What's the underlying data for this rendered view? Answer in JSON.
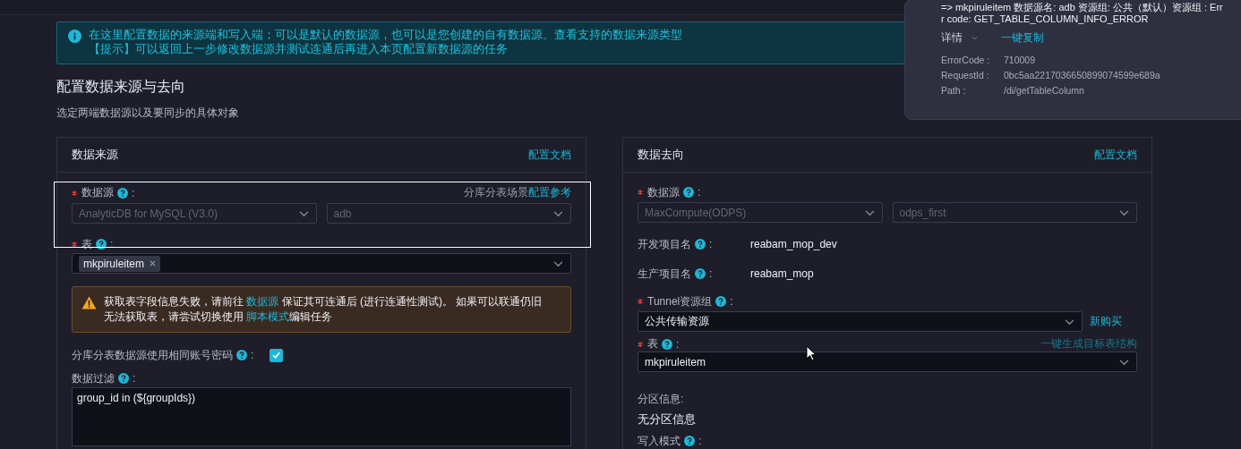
{
  "banner": {
    "lines": [
      "在这里配置数据的来源端和写入端；可以是默认的数据源，也可以是您创建的自有数据源。查看支持的数据来源类型",
      "【提示】可以返回上一步修改数据源并测试连通后再进入本页配置新数据源的任务"
    ]
  },
  "section": {
    "title": "配置数据来源与去向",
    "subtitle": "选定两端数据源以及要同步的具体对象"
  },
  "source": {
    "title": "数据来源",
    "doc_link": "配置文档",
    "datasource": {
      "label": "数据源",
      "colon": ":",
      "required": true,
      "hint": "分库分表场景",
      "hint_link": "配置参考",
      "type": "AnalyticDB for MySQL (V3.0)",
      "name": "adb"
    },
    "table": {
      "label": "表",
      "colon": ":",
      "required": true,
      "tags": [
        "mkpiruleitem"
      ]
    },
    "warning": {
      "segments": [
        {
          "text": "获取表字段信息失败，请前往 ",
          "link": false
        },
        {
          "text": "数据源",
          "link": true
        },
        {
          "text": " 保证其可连通后 (进行连通性测试)。 如果可以联通仍旧无法获取表，请尝试切换使用 ",
          "link": false
        },
        {
          "text": "脚本模式",
          "link": true
        },
        {
          "text": "编辑任务",
          "link": false
        }
      ]
    },
    "same_account": {
      "label": "分库分表数据源使用相同账号密码",
      "colon": ":",
      "checked": true
    },
    "filter": {
      "label": "数据过滤",
      "colon": ":",
      "value": "group_id in (${groupIds})"
    }
  },
  "target": {
    "title": "数据去向",
    "doc_link": "配置文档",
    "datasource": {
      "label": "数据源",
      "colon": ":",
      "required": true,
      "type": "MaxCompute(ODPS)",
      "name": "odps_first"
    },
    "info_rows": [
      {
        "label": "开发项目名",
        "colon": ":",
        "value": "reabam_mop_dev"
      },
      {
        "label": "生产项目名",
        "colon": ":",
        "value": "reabam_mop"
      }
    ],
    "tunnel": {
      "label": "Tunnel资源组",
      "colon": ":",
      "required": true,
      "value": "公共传输资源",
      "action": "新购买"
    },
    "table": {
      "label": "表",
      "colon": ":",
      "required": true,
      "value": "mkpiruleitem",
      "action": "一键生成目标表结构"
    },
    "partition": {
      "label": "分区信息:",
      "value": "无分区信息"
    },
    "write_mode": {
      "label": "写入模式",
      "colon": ":"
    }
  },
  "popup": {
    "lines": [
      "=> mkpiruleitem 数据源名: adb 资源组: 公共（默认）资源组 : Err",
      "r code: GET_TABLE_COLUMN_INFO_ERROR"
    ],
    "details_label": "详情",
    "expanded": false,
    "copy_link": "一键复制",
    "fields": [
      {
        "label": "ErrorCode :",
        "value": "710009"
      },
      {
        "label": "RequestId :",
        "value": "0bc5aa2217036650899074599e689a"
      },
      {
        "label": "Path :",
        "value": "/di/getTableColumn"
      }
    ]
  }
}
